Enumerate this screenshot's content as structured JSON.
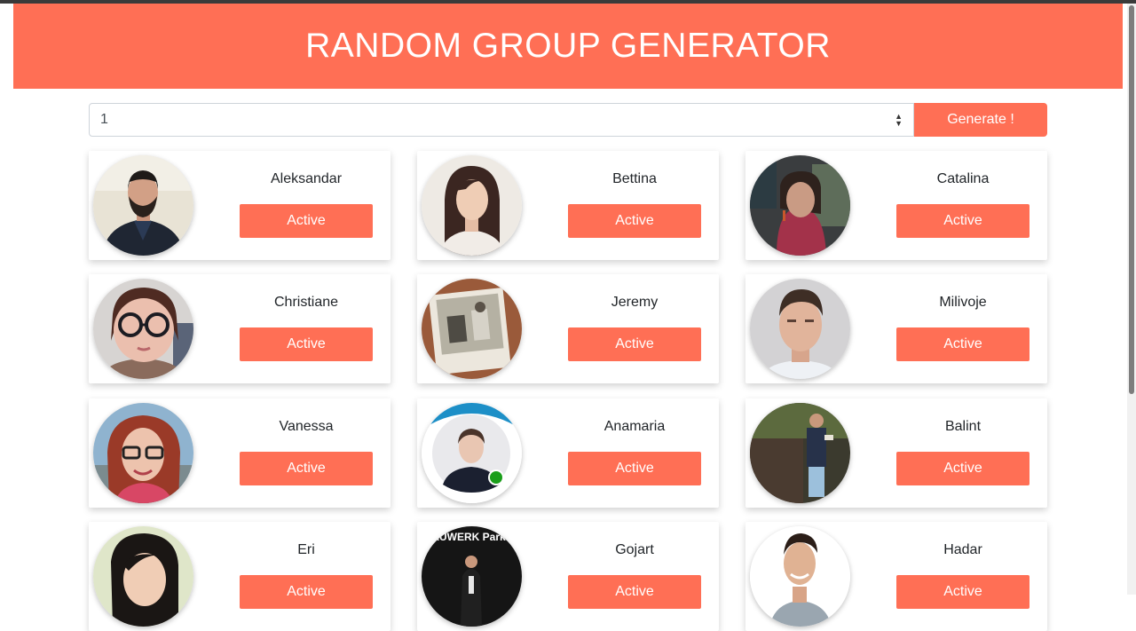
{
  "header": {
    "title": "RANDOM GROUP GENERATOR"
  },
  "controls": {
    "group_size": "1",
    "generate_label": "Generate !"
  },
  "people": [
    {
      "name": "Aleksandar",
      "status": "Active"
    },
    {
      "name": "Bettina",
      "status": "Active"
    },
    {
      "name": "Catalina",
      "status": "Active"
    },
    {
      "name": "Christiane",
      "status": "Active"
    },
    {
      "name": "Jeremy",
      "status": "Active"
    },
    {
      "name": "Milivoje",
      "status": "Active"
    },
    {
      "name": "Vanessa",
      "status": "Active"
    },
    {
      "name": "Anamaria",
      "status": "Active"
    },
    {
      "name": "Balint",
      "status": "Active"
    },
    {
      "name": "Eri",
      "status": "Active"
    },
    {
      "name": "Gojart",
      "status": "Active",
      "photo_text": "BAUWERK Parkett"
    },
    {
      "name": "Hadar",
      "status": "Active"
    }
  ],
  "colors": {
    "accent": "#ff6f55",
    "card_bg": "#ffffff",
    "text": "#212529"
  }
}
